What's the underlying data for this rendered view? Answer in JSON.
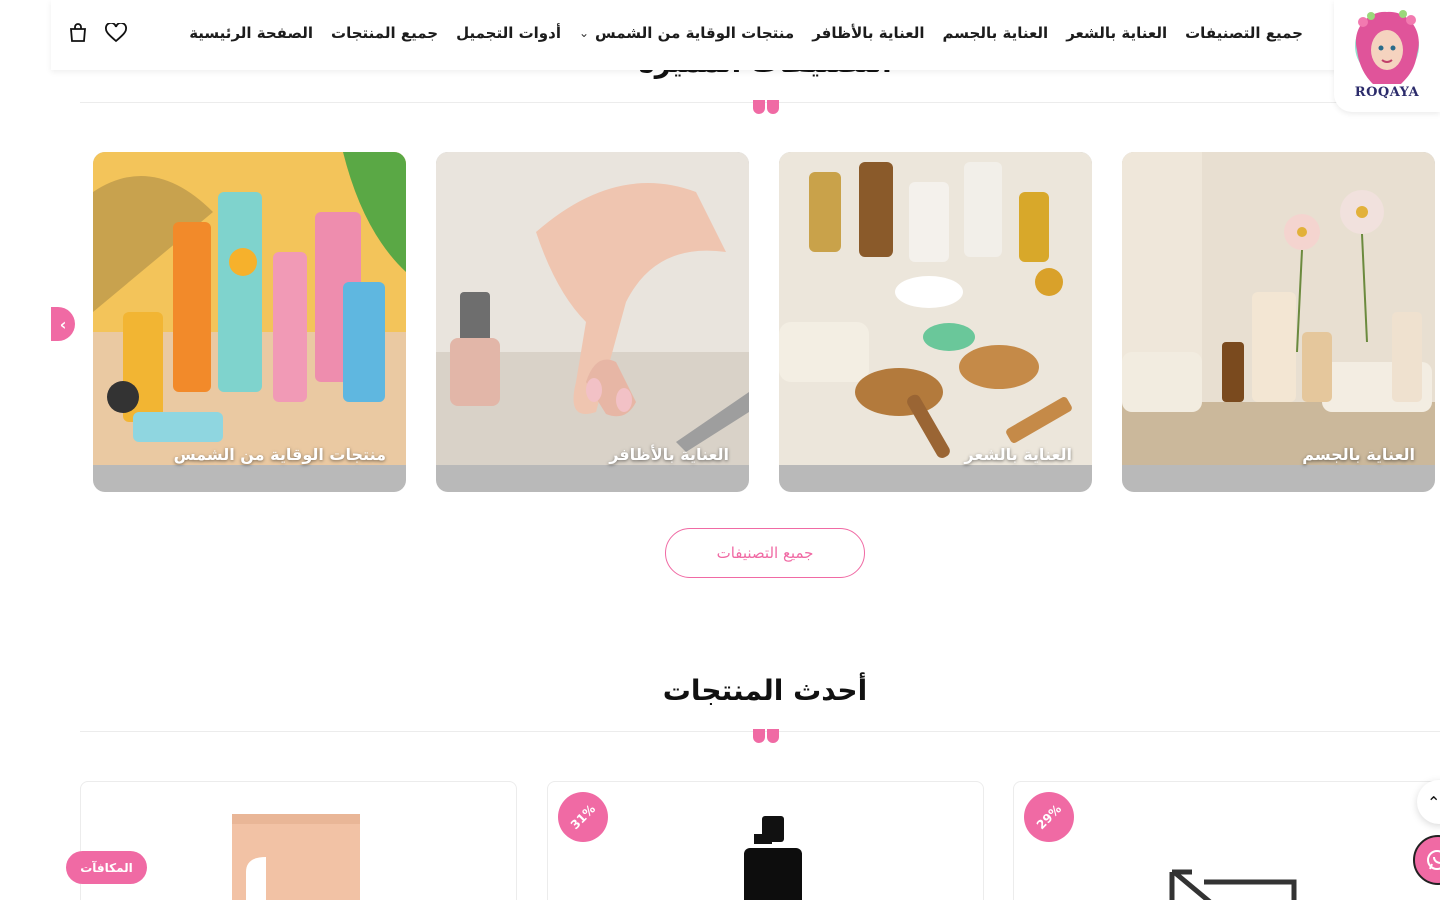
{
  "brand": {
    "logo_text": "ROQAYA"
  },
  "nav": {
    "items": [
      {
        "label": "الصفحة الرئيسية"
      },
      {
        "label": "جميع المنتجات"
      },
      {
        "label": "أدوات التجميل"
      },
      {
        "label": "منتجات الوقاية من الشمس"
      },
      {
        "label": "العناية بالأظافر"
      },
      {
        "label": "العناية بالجسم"
      },
      {
        "label": "العناية بالشعر"
      },
      {
        "label": "جميع التصنيفات"
      }
    ]
  },
  "featured": {
    "title": "التصنيفات المميزة",
    "cards": [
      {
        "label": "العناية بالجسم",
        "icon": "body-care-image"
      },
      {
        "label": "العناية بالشعر",
        "icon": "hair-care-image"
      },
      {
        "label": "العناية بالأظافر",
        "icon": "nail-care-image"
      },
      {
        "label": "منتجات الوقاية من الشمس",
        "icon": "sunscreen-image"
      }
    ],
    "all_button": "جميع التصنيفات"
  },
  "latest": {
    "title": "أحدث المنتجات",
    "products": [
      {
        "badge": "29%"
      },
      {
        "badge": "31%"
      },
      {
        "badge": ""
      }
    ]
  },
  "rewards_label": "المكافآت",
  "colors": {
    "accent": "#f06aa4",
    "text": "#111111"
  }
}
